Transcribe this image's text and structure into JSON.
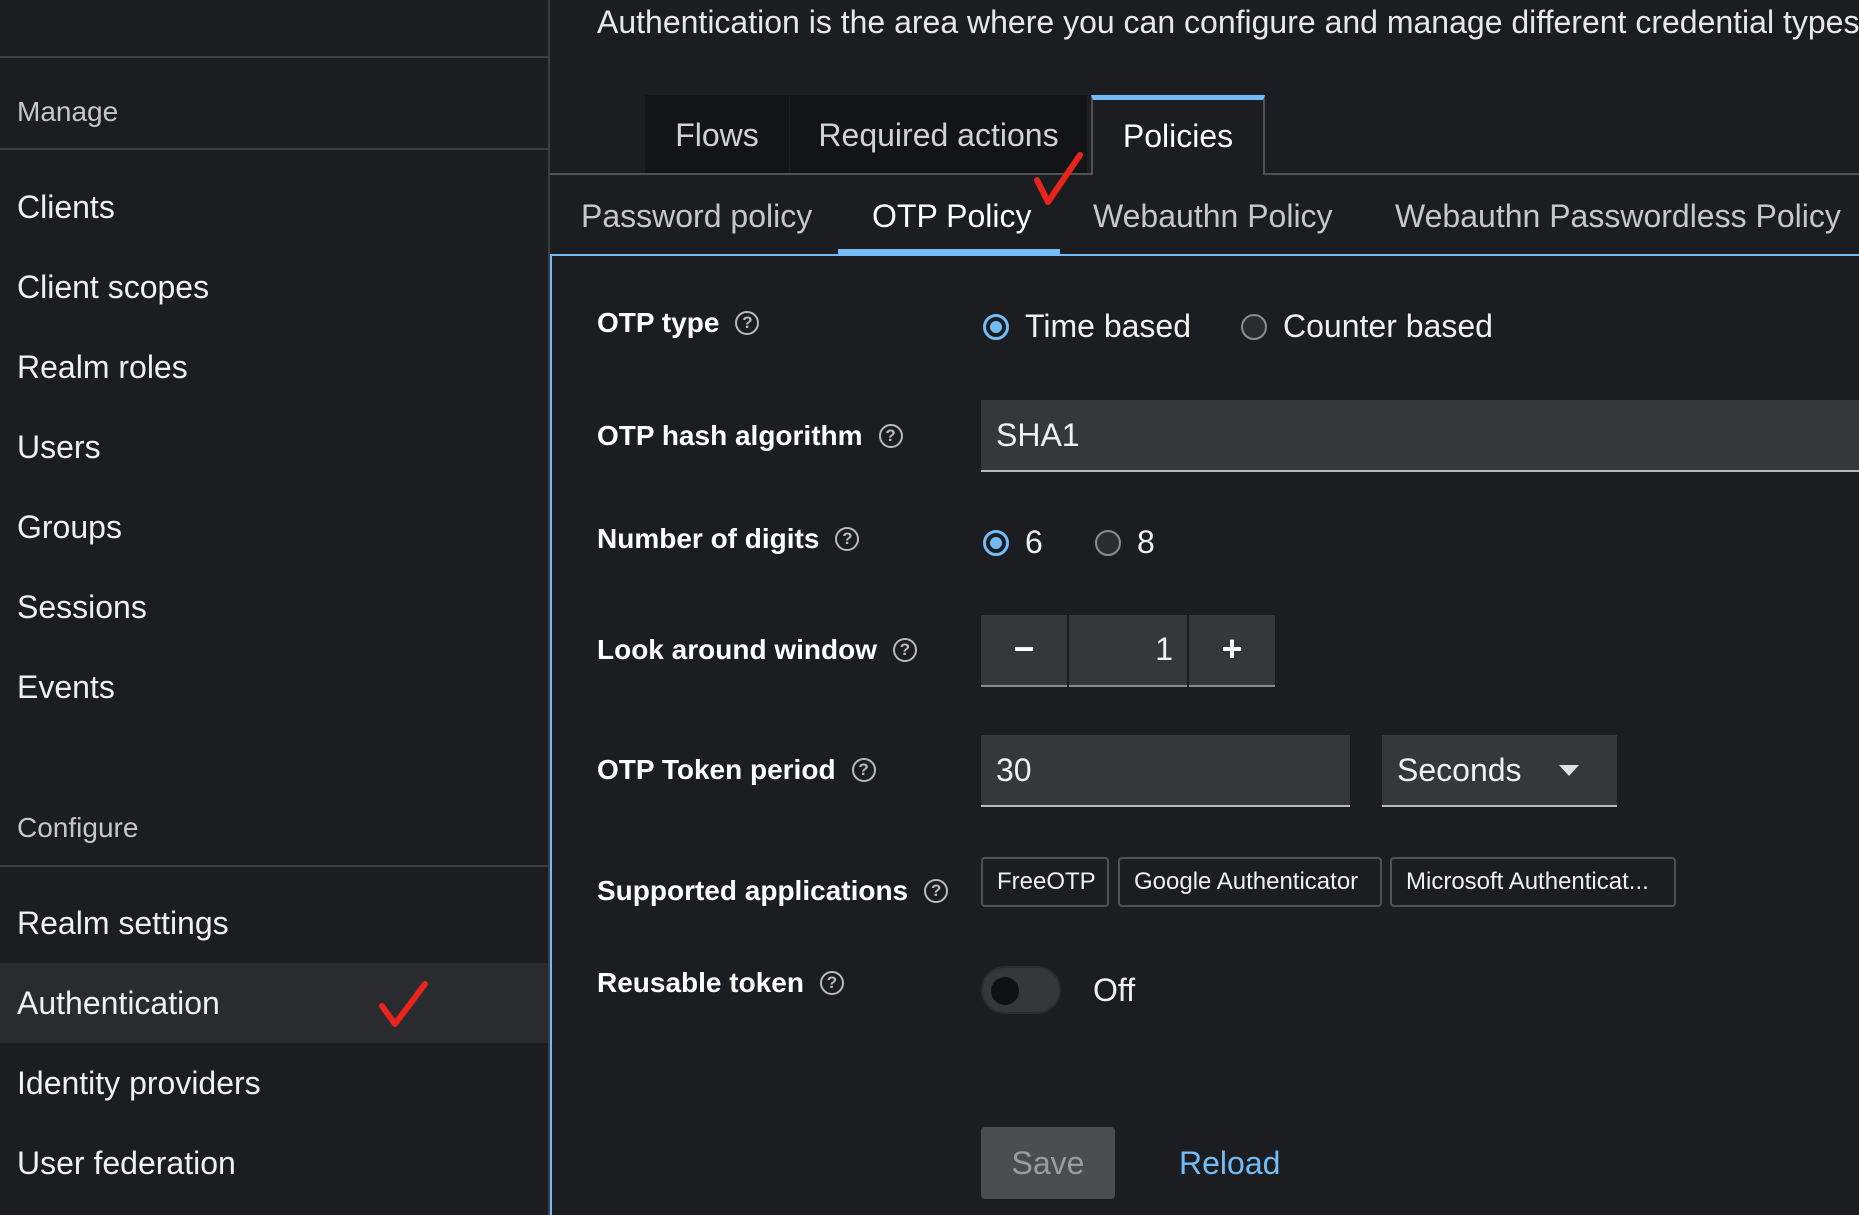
{
  "sidebar": {
    "manage_heading": "Manage",
    "manage_items": [
      {
        "label": "Clients"
      },
      {
        "label": "Client scopes"
      },
      {
        "label": "Realm roles"
      },
      {
        "label": "Users"
      },
      {
        "label": "Groups"
      },
      {
        "label": "Sessions"
      },
      {
        "label": "Events"
      }
    ],
    "configure_heading": "Configure",
    "configure_items": [
      {
        "label": "Realm settings"
      },
      {
        "label": "Authentication"
      },
      {
        "label": "Identity providers"
      },
      {
        "label": "User federation"
      }
    ],
    "active_item": "Authentication"
  },
  "page": {
    "intro_text": "Authentication is the area where you can configure and manage different credential types"
  },
  "tabs": [
    {
      "label": "Flows"
    },
    {
      "label": "Required actions"
    },
    {
      "label": "Policies"
    }
  ],
  "active_tab": "Policies",
  "subtabs": [
    {
      "label": "Password policy"
    },
    {
      "label": "OTP Policy"
    },
    {
      "label": "Webauthn Policy"
    },
    {
      "label": "Webauthn Passwordless Policy"
    }
  ],
  "active_subtab": "OTP Policy",
  "form": {
    "otp_type": {
      "label": "OTP type",
      "options": [
        "Time based",
        "Counter based"
      ],
      "selected": "Time based"
    },
    "hash_algorithm": {
      "label": "OTP hash algorithm",
      "value": "SHA1"
    },
    "digits": {
      "label": "Number of digits",
      "options": [
        "6",
        "8"
      ],
      "selected": "6"
    },
    "look_around": {
      "label": "Look around window",
      "value": "1",
      "minus": "−",
      "plus": "+"
    },
    "token_period": {
      "label": "OTP Token period",
      "value": "30",
      "unit": "Seconds"
    },
    "supported_apps": {
      "label": "Supported applications",
      "chips": [
        "FreeOTP",
        "Google Authenticator",
        "Microsoft Authenticat..."
      ]
    },
    "reusable_token": {
      "label": "Reusable token",
      "state": "Off"
    },
    "help_glyph": "?"
  },
  "actions": {
    "save": "Save",
    "reload": "Reload"
  },
  "colors": {
    "accent": "#73bcf7",
    "annotation_check": "#e8241b"
  }
}
